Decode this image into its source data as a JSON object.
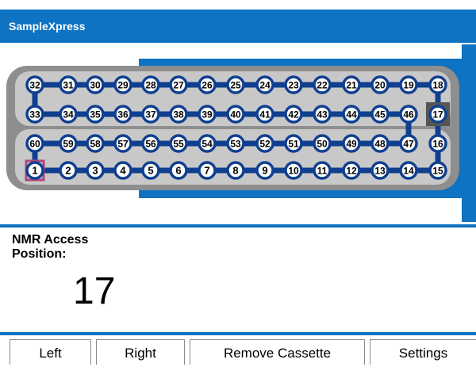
{
  "app": {
    "title": "SampleXpress"
  },
  "positions": {
    "row1": [
      32,
      31,
      30,
      29,
      28,
      27,
      26,
      25,
      24,
      23,
      22,
      21,
      20,
      19,
      18
    ],
    "row2": [
      33,
      34,
      35,
      36,
      37,
      38,
      39,
      40,
      41,
      42,
      43,
      44,
      45,
      46,
      17
    ],
    "row3": [
      60,
      59,
      58,
      57,
      56,
      55,
      54,
      53,
      52,
      51,
      50,
      49,
      48,
      47,
      16
    ],
    "row4": [
      1,
      2,
      3,
      4,
      5,
      6,
      7,
      8,
      9,
      10,
      11,
      12,
      13,
      14,
      15
    ],
    "nmr_access_slot": 17,
    "selected_slot": 1
  },
  "status": {
    "label_line1": "NMR Access",
    "label_line2": "Position:",
    "value": "17"
  },
  "buttons": {
    "left": "Left",
    "right": "Right",
    "remove": "Remove Cassette",
    "settings": "Settings"
  },
  "colors": {
    "accent": "#0e73c2",
    "ring": "#0f3f8f",
    "tray": "#c8c8c8",
    "tray_dark": "#8e8e8e",
    "selected": "#b0457d",
    "access": "#555555"
  }
}
